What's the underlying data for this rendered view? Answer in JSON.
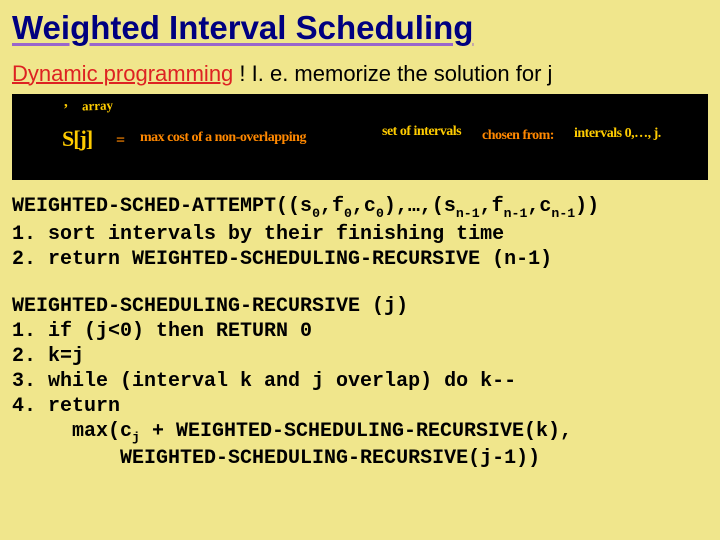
{
  "title": "Weighted Interval Scheduling",
  "subtitle": {
    "dp": "Dynamic programming",
    "rest": " !  I. e. memorize the solution for j"
  },
  "board": {
    "array_label": "array",
    "scribble1": ",",
    "sj": "S[j]",
    "eq": "=",
    "desc1": "max cost of a non-overlapping",
    "desc2": "set of intervals",
    "desc3": "chosen from:",
    "desc4": "intervals 0,…, j."
  },
  "code1": {
    "l1a": "WEIGHTED-SCHED-ATTEMPT((s",
    "l1b": ",f",
    "l1c": ",c",
    "l1d": "),…,(s",
    "l1e": ",f",
    "l1f": ",c",
    "l1g": "))",
    "sub0a": "0",
    "sub0b": "0",
    "sub0c": "0",
    "subna": "n-1",
    "subnb": "n-1",
    "subnc": "n-1",
    "l2": "1. sort intervals by their finishing time",
    "l3": "2. return WEIGHTED-SCHEDULING-RECURSIVE (n-1)"
  },
  "code2": {
    "l1": "WEIGHTED-SCHEDULING-RECURSIVE (j)",
    "l2": "1. if (j<0) then RETURN 0",
    "l3": "2. k=j",
    "l4": "3. while (interval k and j overlap) do k--",
    "l5": "4. return",
    "l6a": "     max(c",
    "l6sub": "j",
    "l6b": " + WEIGHTED-SCHEDULING-RECURSIVE(k),",
    "l7": "         WEIGHTED-SCHEDULING-RECURSIVE(j-1))"
  }
}
